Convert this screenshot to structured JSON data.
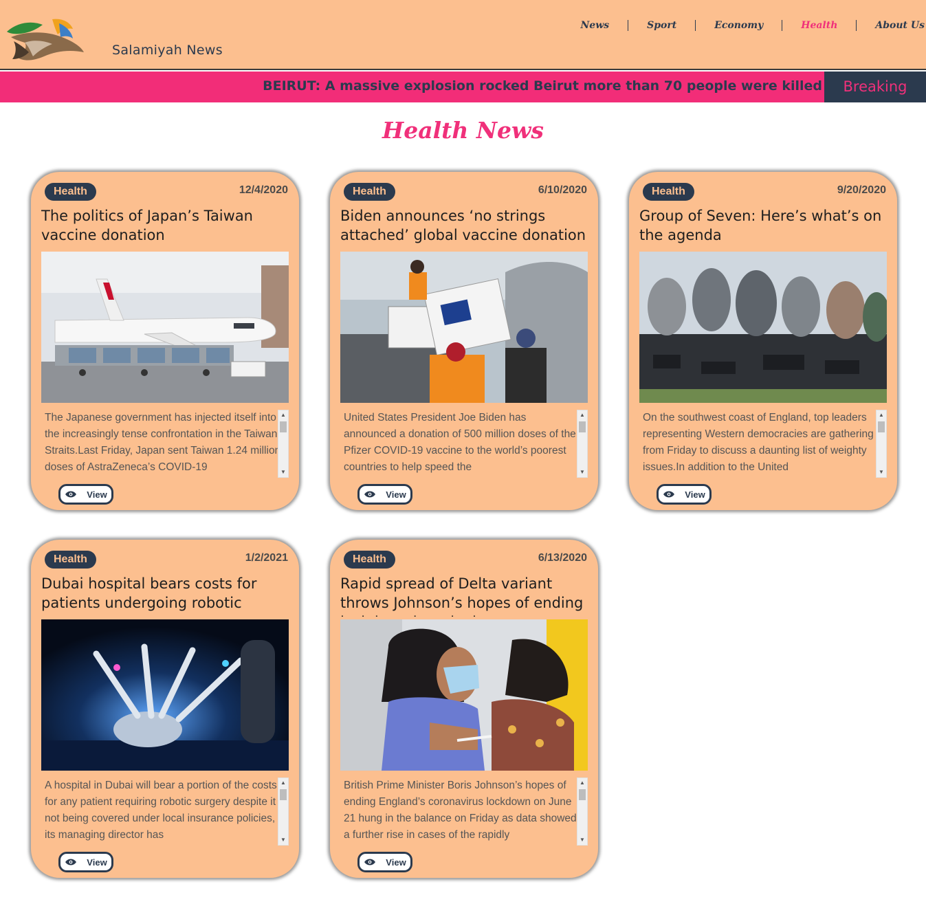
{
  "header": {
    "site_name": "Salamiyah News",
    "nav": [
      {
        "label": "News",
        "active": false
      },
      {
        "label": "Sport",
        "active": false
      },
      {
        "label": "Economy",
        "active": false
      },
      {
        "label": "Health",
        "active": true
      },
      {
        "label": "About Us",
        "active": false
      }
    ],
    "separator": "|"
  },
  "breaking": {
    "ticker": "BEIRUT: A massive explosion rocked Beirut more than 70 people were killed",
    "label": "Breaking"
  },
  "page_title": "Health News",
  "colors": {
    "peach": "#fcbf8f",
    "pink": "#f22d78",
    "navy": "#2b3a4e"
  },
  "cards": [
    {
      "category": "Health",
      "date": "12/4/2020",
      "title": "The politics of Japan’s Taiwan vaccine donation",
      "image": "airplane-cargo-photo",
      "text": "The Japanese government has injected itself into the increasingly tense confrontation in the Taiwan Straits.Last Friday, Japan sent Taiwan 1.24 million doses of AstraZeneca’s COVID-19",
      "button": "View"
    },
    {
      "category": "Health",
      "date": "6/10/2020",
      "title": "Biden announces ‘no strings attached’ global vaccine donation",
      "image": "vaccine-boxes-unloading-photo",
      "text": "United States President Joe Biden has announced a donation of 500 million doses of the Pfizer COVID-19 vaccine to the world’s poorest countries to help speed the",
      "button": "View"
    },
    {
      "category": "Health",
      "date": "9/20/2020",
      "title": "Group of Seven: Here’s what’s on the agenda",
      "image": "g7-sculpture-photo",
      "text": "On the southwest coast of England, top leaders representing Western democracies are gathering from Friday to discuss a daunting list of weighty issues.In addition to the United",
      "button": "View"
    },
    {
      "category": "Health",
      "date": "1/2/2021",
      "title": "Dubai hospital bears costs for patients undergoing robotic surgery",
      "image": "surgical-robot-photo",
      "text": "A hospital in Dubai will bear a portion of the costs for any patient requiring robotic surgery despite it not being covered under local insurance policies, its managing director has",
      "button": "View"
    },
    {
      "category": "Health",
      "date": "6/13/2020",
      "title": "Rapid spread of Delta variant throws Johnson’s hopes of ending lockdown into doubt",
      "image": "vaccination-photo",
      "text": "British Prime Minister Boris Johnson’s hopes of ending England’s coronavirus lockdown on June 21 hung in the balance on Friday as data showed a further rise in cases of the rapidly",
      "button": "View"
    }
  ]
}
